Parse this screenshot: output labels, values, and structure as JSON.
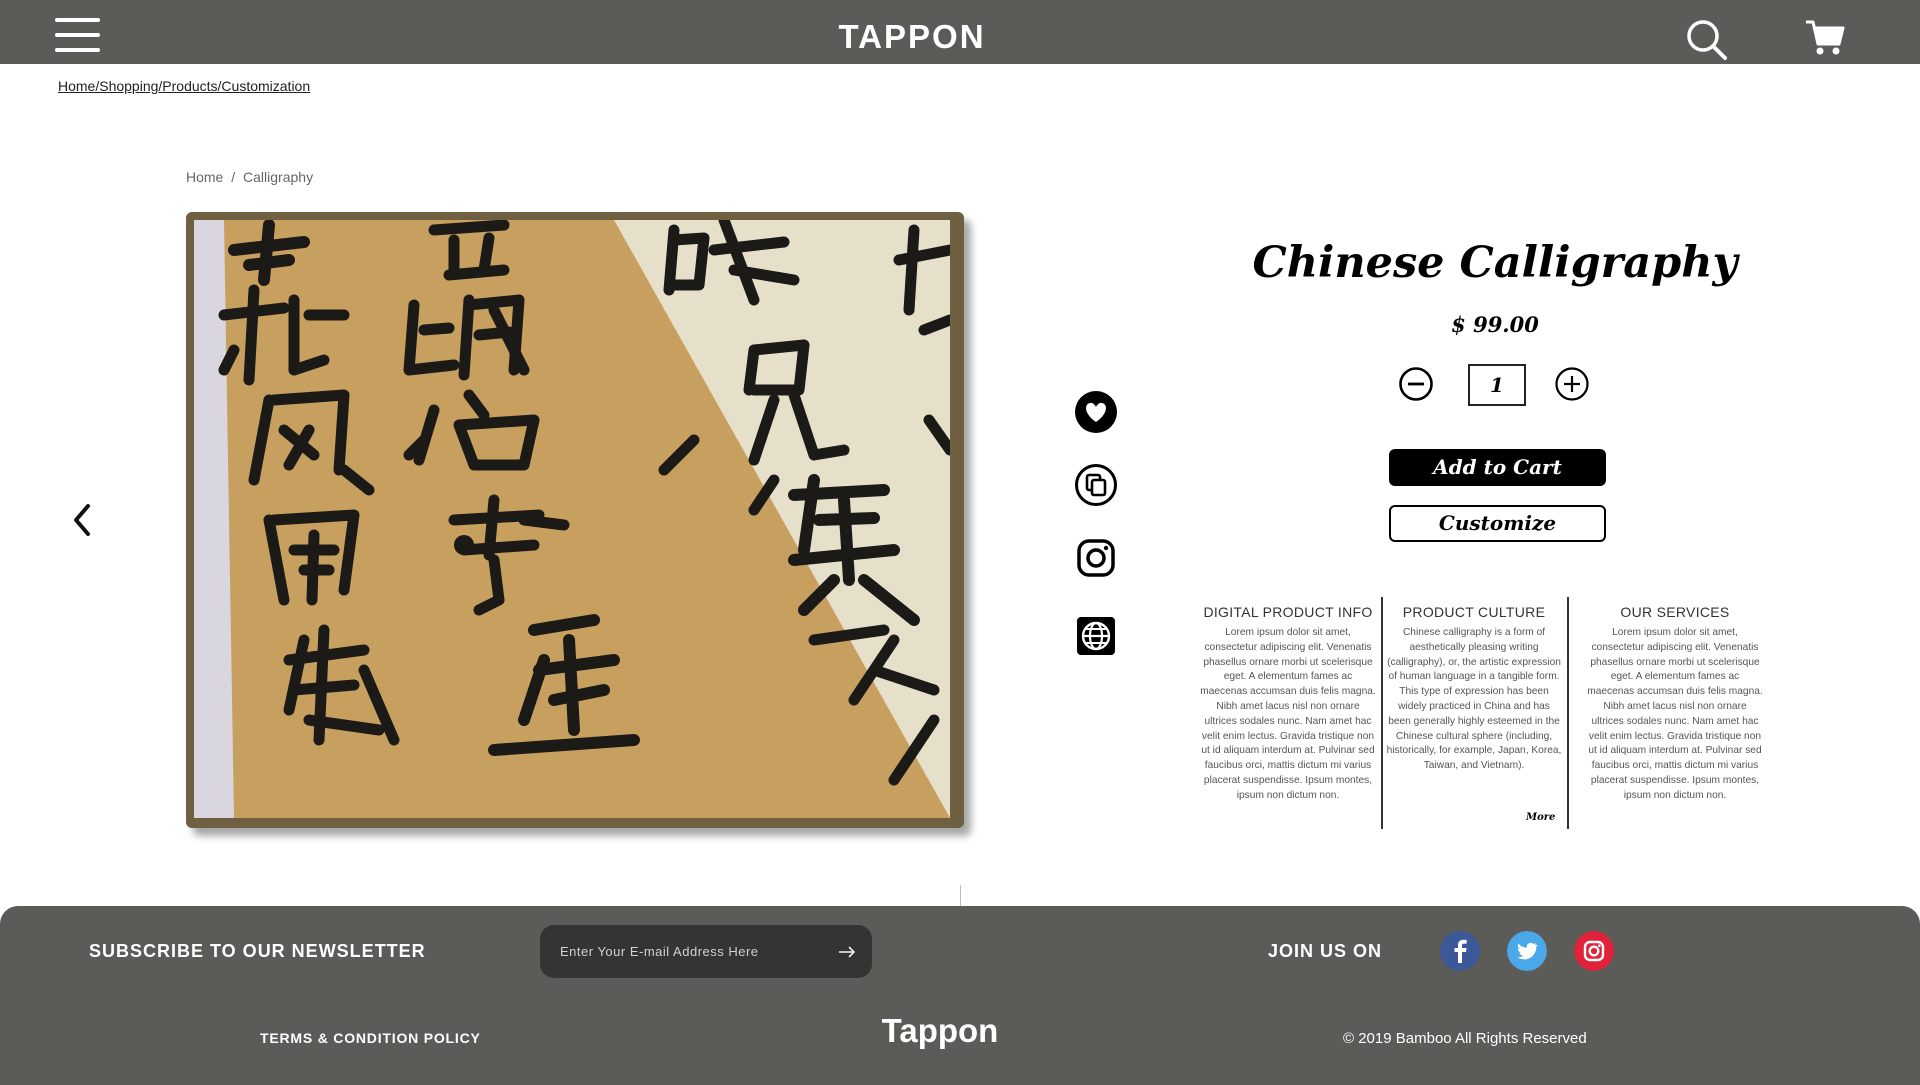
{
  "header": {
    "brand": "TAPPON",
    "menu_icon": "hamburger-menu-icon",
    "search_icon": "search-icon",
    "cart_icon": "shopping-cart-icon"
  },
  "breadcrumb_top": "Home/Shopping/Products/Customization",
  "breadcrumb_inner": {
    "items": [
      "Home",
      "Calligraphy"
    ],
    "separator": "/"
  },
  "gallery": {
    "prev_icon": "chevron-left-icon",
    "image_subject": "calligraphy-scroll-photo"
  },
  "side_actions": [
    {
      "icon": "heart-icon"
    },
    {
      "icon": "copy-icon"
    },
    {
      "icon": "instagram-icon"
    },
    {
      "icon": "globe-icon"
    }
  ],
  "product": {
    "title": "Chinese Calligraphy",
    "price": "$ 99.00",
    "quantity": "1",
    "add_to_cart": "Add to Cart",
    "customize": "Customize"
  },
  "info_columns": [
    {
      "heading": "DIGITAL PRODUCT INFO",
      "body": "Lorem ipsum dolor sit amet, consectetur adipiscing elit. Venenatis phasellus ornare morbi ut scelerisque eget. A elementum fames ac maecenas accumsan duis felis magna. Nibh amet lacus nisl non ornare ultrices sodales nunc. Nam amet hac velit enim lectus. Gravida tristique non ut id aliquam interdum at. Pulvinar sed faucibus orci, mattis dictum mi varius placerat suspendisse. Ipsum montes, ipsum non dictum non."
    },
    {
      "heading": "PRODUCT CULTURE",
      "body": "Chinese calligraphy is a form of aesthetically pleasing writing (calligraphy), or, the artistic expression of human language in a tangible form. This type of expression has been widely practiced in China and has been generally highly esteemed in the Chinese cultural sphere (including, historically, for example, Japan, Korea, Taiwan, and Vietnam).",
      "more": "More"
    },
    {
      "heading": "OUR SERVICES",
      "body": "Lorem ipsum dolor sit amet, consectetur adipiscing elit. Venenatis phasellus ornare morbi ut scelerisque eget. A elementum fames ac maecenas accumsan duis felis magna. Nibh amet lacus nisl non ornare ultrices sodales nunc. Nam amet hac velit enim lectus. Gravida tristique non ut id aliquam interdum at. Pulvinar sed faucibus orci, mattis dictum mi varius placerat suspendisse. Ipsum montes, ipsum non dictum non."
    }
  ],
  "footer": {
    "newsletter_label": "SUBSCRIBE TO OUR NEWSLETTER",
    "email_placeholder": "Enter Your E-mail Address Here",
    "submit_icon": "arrow-right-icon",
    "join_label": "JOIN US ON",
    "social": [
      {
        "icon": "facebook-icon",
        "color": "#3b5998"
      },
      {
        "icon": "twitter-icon",
        "color": "#4aa8e8"
      },
      {
        "icon": "instagram-icon",
        "color": "#e0223b"
      }
    ],
    "terms": "TERMS & CONDITION POLICY",
    "brand": "Tappon",
    "copyright": "© 2019 Bamboo All Rights Reserved"
  },
  "colors": {
    "header_bg": "#5b5b58",
    "footer_bg": "#5b5b58",
    "email_box_bg": "#343434",
    "frame_brown": "#6f6042",
    "paper_gold": "#c9a160",
    "paper_cream": "#e4dcc4",
    "ink": "#1c1a17"
  }
}
